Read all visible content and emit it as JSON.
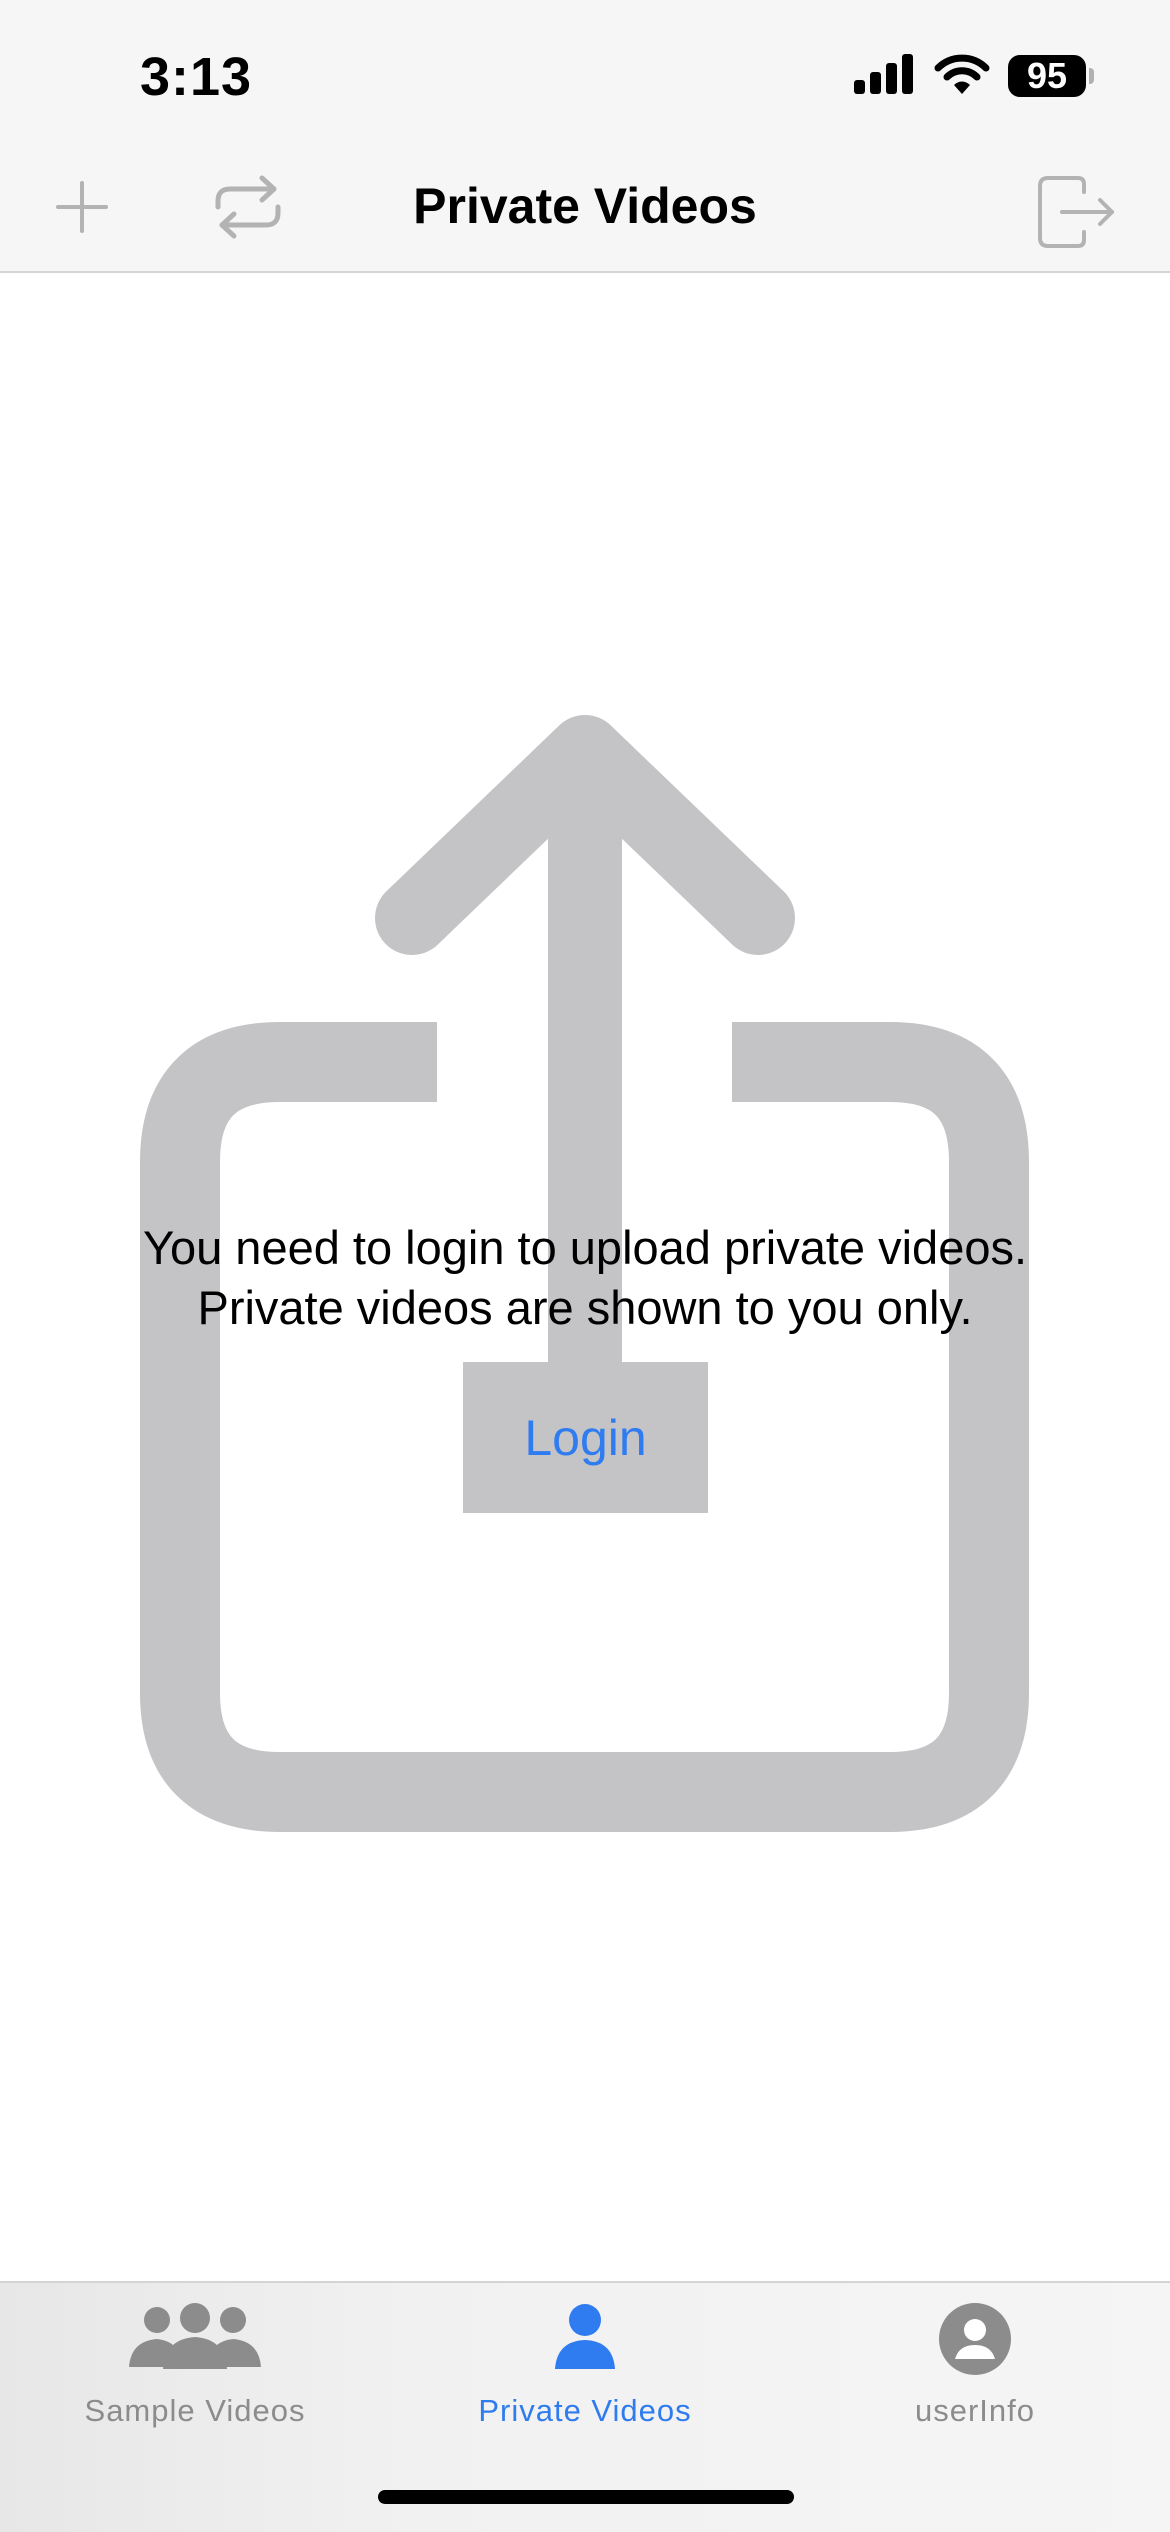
{
  "status_bar": {
    "time": "3:13",
    "battery": "95"
  },
  "nav_bar": {
    "title": "Private Videos",
    "left_icons": [
      "plus-icon",
      "repeat-icon"
    ],
    "right_icon": "logout-icon"
  },
  "main": {
    "message_line1": "You need to login to upload private videos.",
    "message_line2": "Private videos are shown to you only.",
    "login_label": "Login",
    "background_icon": "share-upload-icon"
  },
  "tab_bar": {
    "tabs": [
      {
        "label": "Sample Videos",
        "icon": "group-icon",
        "active": false
      },
      {
        "label": "Private Videos",
        "icon": "person-icon",
        "active": true
      },
      {
        "label": "userInfo",
        "icon": "person-circle-icon",
        "active": false
      }
    ]
  },
  "colors": {
    "accent": "#2F7BF0",
    "inactive": "#8C8C8C",
    "illustration": "#C4C4C6",
    "bar_background": "#F6F6F6"
  }
}
